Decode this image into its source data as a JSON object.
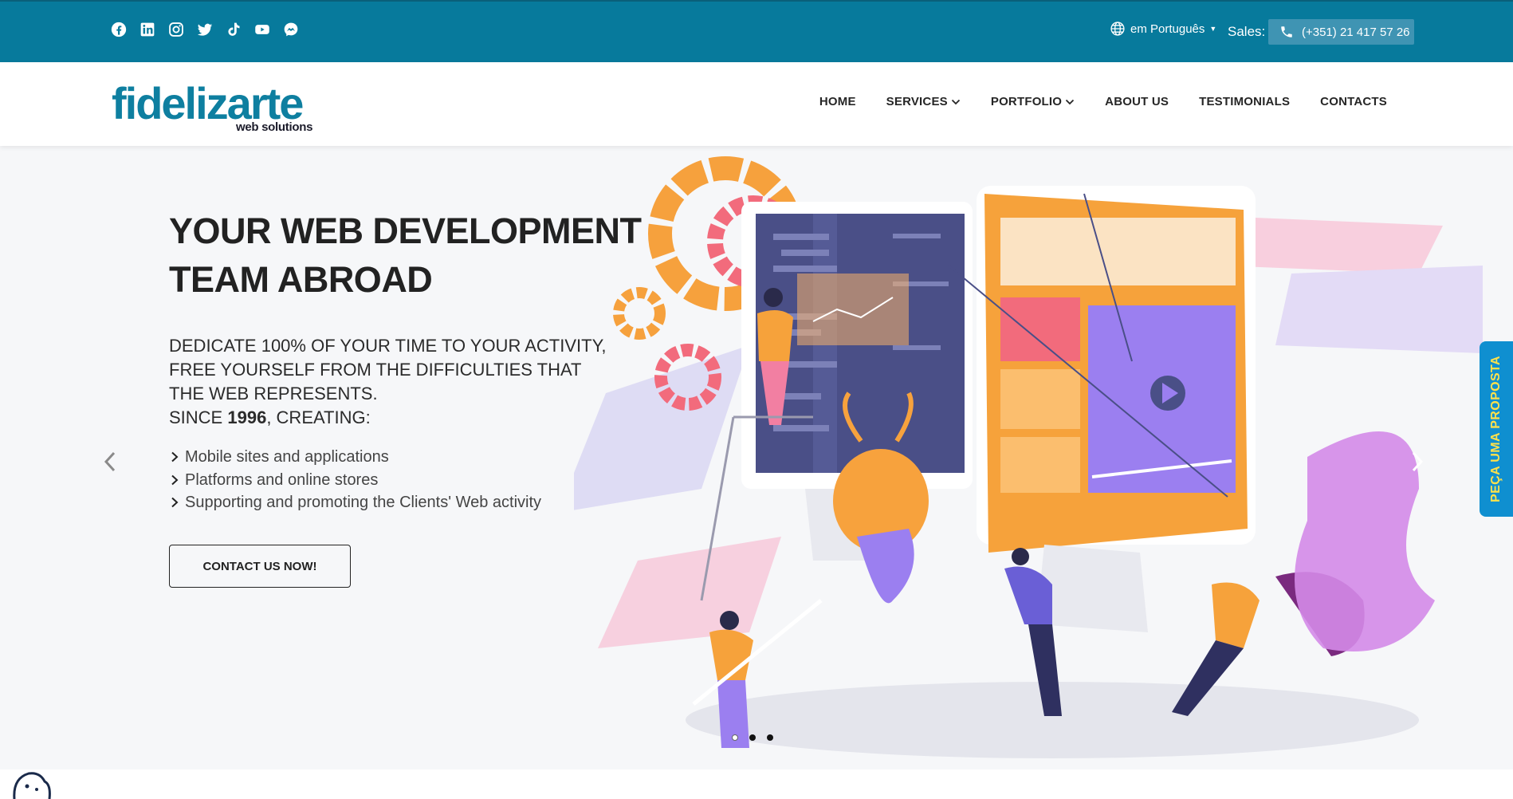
{
  "topbar": {
    "social_icons": [
      "facebook-icon",
      "linkedin-icon",
      "instagram-icon",
      "twitter-icon",
      "tiktok-icon",
      "youtube-icon",
      "messenger-icon"
    ],
    "language": "em Português",
    "sales_label": "Sales:",
    "phone": "(+351) 21 417 57 26",
    "bg_color": "#077a9c"
  },
  "logo": {
    "brand": "fidelizarte",
    "subtitle": "web solutions",
    "color": "#0e7fa0"
  },
  "nav": {
    "items": [
      {
        "label": "HOME",
        "dropdown": false
      },
      {
        "label": "SERVICES",
        "dropdown": true
      },
      {
        "label": "PORTFOLIO",
        "dropdown": true
      },
      {
        "label": "ABOUT US",
        "dropdown": false
      },
      {
        "label": "TESTIMONIALS",
        "dropdown": false
      },
      {
        "label": "CONTACTS",
        "dropdown": false
      }
    ]
  },
  "hero": {
    "title_line1": "YOUR WEB DEVELOPMENT",
    "title_line2": "TEAM ABROAD",
    "text_line1": "DEDICATE 100% OF YOUR TIME TO YOUR ACTIVITY,",
    "text_line2": "FREE YOURSELF FROM THE DIFFICULTIES THAT",
    "text_line3": "THE WEB REPRESENTS.",
    "text_since": "SINCE ",
    "text_year": "1996",
    "text_after": ", CREATING:",
    "list": [
      "Mobile sites and applications",
      "Platforms and online stores",
      "Supporting and promoting the Clients' Web activity"
    ],
    "cta_label": "CONTACT US NOW!",
    "slides": 3,
    "active_slide": 1
  },
  "side_tab": {
    "label": "PEÇA UMA PROPOSTA",
    "bg_color": "#0f8fd0",
    "text_color": "#ffe14a"
  }
}
